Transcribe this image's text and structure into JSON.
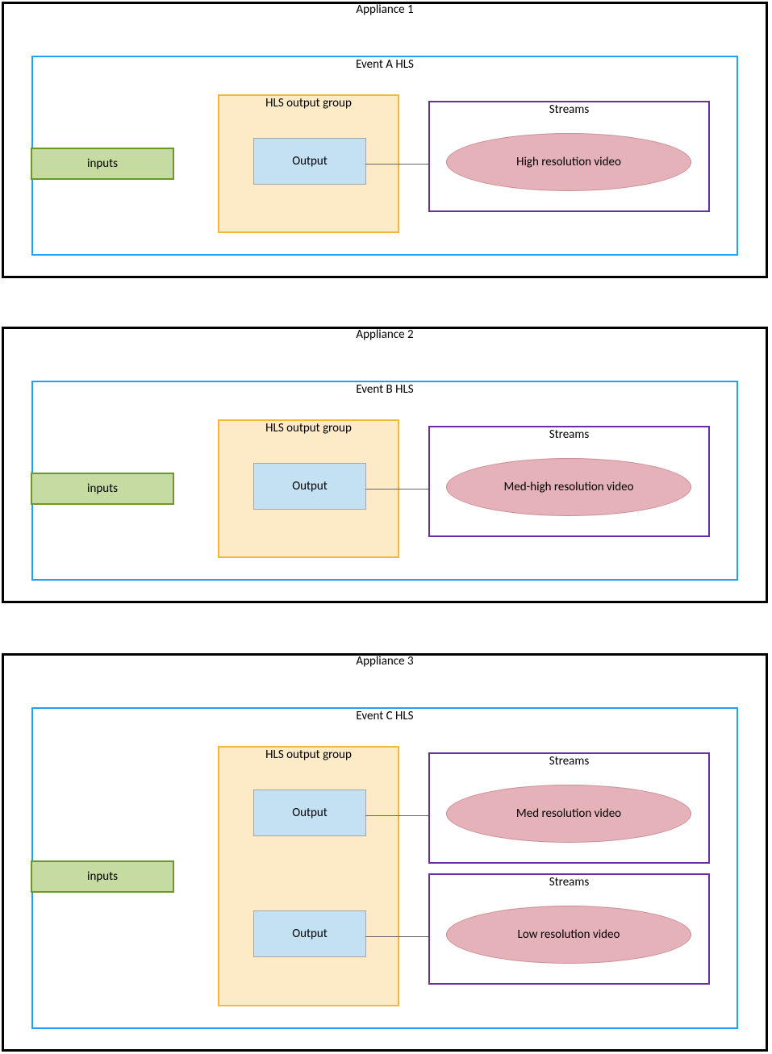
{
  "appliances": [
    {
      "title": "Appliance 1",
      "event": {
        "title": "Event A HLS",
        "inputs_label": "inputs",
        "output_group": {
          "title": "HLS output group",
          "outputs": [
            {
              "label": "Output",
              "stream_box_title": "Streams",
              "stream_label": "High resolution video"
            }
          ]
        }
      }
    },
    {
      "title": "Appliance 2",
      "event": {
        "title": "Event B HLS",
        "inputs_label": "inputs",
        "output_group": {
          "title": "HLS output group",
          "outputs": [
            {
              "label": "Output",
              "stream_box_title": "Streams",
              "stream_label": "Med-high resolution video"
            }
          ]
        }
      }
    },
    {
      "title": "Appliance 3",
      "event": {
        "title": "Event C HLS",
        "inputs_label": "inputs",
        "output_group": {
          "title": "HLS output group",
          "outputs": [
            {
              "label": "Output",
              "stream_box_title": "Streams",
              "stream_label": "Med resolution video"
            },
            {
              "label": "Output",
              "stream_box_title": "Streams",
              "stream_label": "Low resolution video"
            }
          ]
        }
      }
    }
  ]
}
